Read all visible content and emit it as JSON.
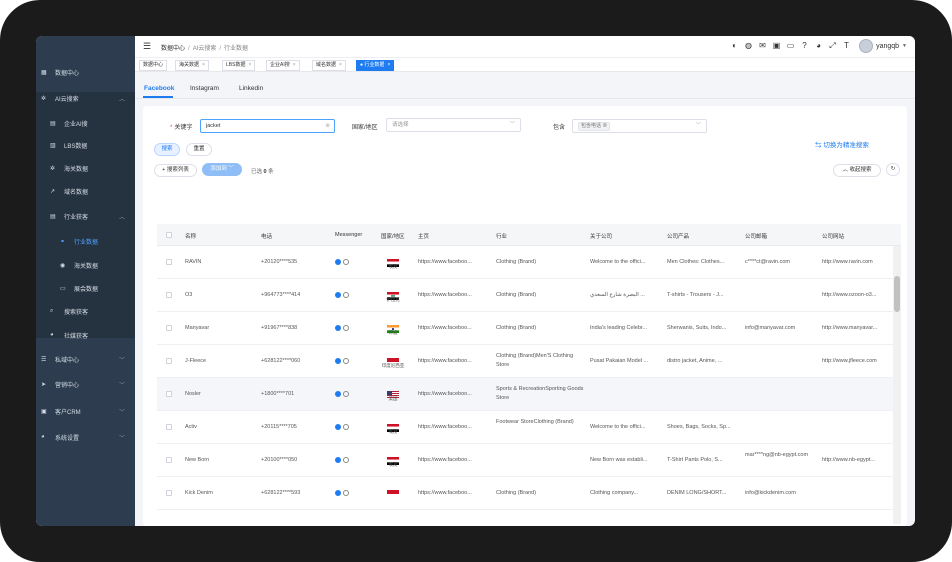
{
  "sidebar": {
    "items": [
      {
        "icon": "chart-icon",
        "label": "数据中心"
      },
      {
        "icon": "gear-icon",
        "label": "AI云搜索"
      },
      {
        "icon": "building-icon",
        "label": "企业AI搜"
      },
      {
        "icon": "lbs-icon",
        "label": "LBS数据"
      },
      {
        "icon": "gear-icon",
        "label": "海关数据"
      },
      {
        "icon": "domain-icon",
        "label": "域名数据"
      },
      {
        "icon": "industry-icon",
        "label": "行业获客"
      },
      {
        "icon": "link-icon",
        "label": "行业数据"
      },
      {
        "icon": "globe-icon",
        "label": "海关数据"
      },
      {
        "icon": "monitor-icon",
        "label": "展会数据"
      },
      {
        "icon": "search-icon",
        "label": "搜索获客"
      },
      {
        "icon": "social-icon",
        "label": "社媒获客"
      },
      {
        "icon": "db-icon",
        "label": "私域中心"
      },
      {
        "icon": "send-icon",
        "label": "营销中心"
      },
      {
        "icon": "crm-icon",
        "label": "客户CRM"
      },
      {
        "icon": "settings-icon",
        "label": "系统设置"
      }
    ]
  },
  "header": {
    "breadcrumb": [
      "数据中心",
      "AI云搜索",
      "行业数据"
    ],
    "username": "yangqb"
  },
  "tabs": [
    {
      "label": "数据中心"
    },
    {
      "label": "海关数据"
    },
    {
      "label": "LBS数据"
    },
    {
      "label": "企业AI搜"
    },
    {
      "label": "域名数据"
    },
    {
      "label": "● 行业数据"
    }
  ],
  "platform_tabs": [
    "Facebook",
    "Instagram",
    "Linkedin"
  ],
  "search": {
    "keyword_label": "关键字",
    "keyword_value": "jacket",
    "country_label": "国家/地区",
    "country_placeholder": "请选择",
    "contains_label": "包含",
    "contains_chip": "包含电话",
    "search_button": "搜索",
    "reset_button": "重置",
    "switch_link": "切换为精准搜索",
    "more_fields_button": "搜索列表",
    "add_button": "添加到",
    "selected_prefix": "已选",
    "selected_count": "0",
    "selected_suffix": "条",
    "collapse_button": "收起搜索"
  },
  "table": {
    "columns": [
      "名称",
      "电话",
      "Messenger",
      "国家/地区",
      "主页",
      "行业",
      "关于公司",
      "公司产品",
      "公司邮箱",
      "公司网站"
    ],
    "rows": [
      {
        "name": "RAVIN",
        "phone": "+20120****535",
        "country": "埃及",
        "flag": "egypt",
        "homepage": "https://www.faceboo...",
        "industry": "Clothing (Brand)",
        "about": "Welcome to the offici...",
        "products": "Men Clothes: Clothes...",
        "email": "c****ct@ravin.com",
        "website": "http://www.ravin.com"
      },
      {
        "name": "O3",
        "phone": "+964773****414",
        "country": "伊拉克",
        "flag": "iraq",
        "homepage": "https://www.faceboo...",
        "industry": "Clothing (Brand)",
        "about": "البصرة شارع السعدي ...",
        "products": "T-shirts - Trousers - J...",
        "email": "",
        "website": "http://www.ozoon-o3..."
      },
      {
        "name": "Manyavar",
        "phone": "+91967****838",
        "country": "印度",
        "flag": "india",
        "homepage": "https://www.faceboo...",
        "industry": "Clothing (Brand)",
        "about": "India's leading Celebr...",
        "products": "Sherwanis, Suits, Indo...",
        "email": "info@manyavar.com",
        "website": "http://www.manyavar..."
      },
      {
        "name": "J-Fleece",
        "phone": "+628122****060",
        "country": "印度尼西亚",
        "flag": "indonesia",
        "homepage": "https://www.faceboo...",
        "industry": "Clothing (Brand)Men'S Clothing Store",
        "about": "Pusat Pakaian Model ...",
        "products": "distro jacket, Anime, ...",
        "email": "",
        "website": "http://www.jfleece.com"
      },
      {
        "name": "Nosler",
        "phone": "+1800****701",
        "country": "美国",
        "flag": "usa",
        "homepage": "https://www.faceboo...",
        "industry": "Sports & RecreationSporting Goods Store",
        "about": "",
        "products": "",
        "email": "",
        "website": ""
      },
      {
        "name": "Activ",
        "phone": "+20115****705",
        "country": "埃及",
        "flag": "egypt",
        "homepage": "https://www.faceboo...",
        "industry": "Footwear StoreClothing (Brand)",
        "about": "Welcome to the offici...",
        "products": "Shoes, Bags, Socks, Sp...",
        "email": "",
        "website": ""
      },
      {
        "name": "New Born",
        "phone": "+20100****050",
        "country": "埃及",
        "flag": "egypt",
        "homepage": "https://www.faceboo...",
        "industry": "",
        "about": "New Born was establi...",
        "products": "T-Shirt Pants Polo, S...",
        "email": "mar****ng@nb-egypt.com",
        "website": "http://www.nb-egypt..."
      },
      {
        "name": "Kick Denim",
        "phone": "+628122****593",
        "country": "",
        "flag": "indonesia",
        "homepage": "https://www.faceboo...",
        "industry": "Clothing (Brand)",
        "about": "Clothing company...",
        "products": "DENIM LONG/SHORT...",
        "email": "info@kickdenim.com",
        "website": ""
      }
    ]
  },
  "colors": {
    "sidebar_bg": "#2d3d4f",
    "accent": "#1f7cf0",
    "active_tab": "#1f7cf0"
  }
}
